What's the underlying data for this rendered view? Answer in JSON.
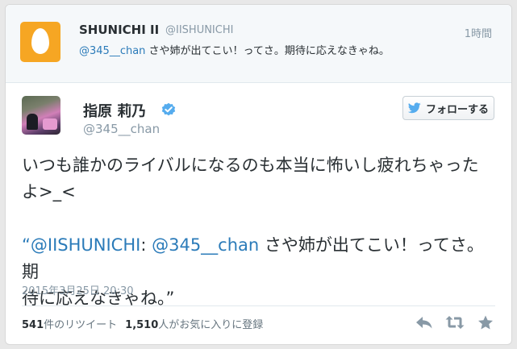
{
  "parent": {
    "name": "SHUNICHI II",
    "handle": "@IISHUNICHI",
    "time": "1時間",
    "mention": "@345__chan",
    "text": "さや姉が出てこい！ってさ。期待に応えなきゃね。"
  },
  "tweet": {
    "name": "指原 莉乃",
    "handle": "@345__chan",
    "line1": "いつも誰かのライバルになるのも本当に怖いし疲れちゃった",
    "line2": "よ>_<",
    "quote_open": "“",
    "quote_mention1": "@IISHUNICHI",
    "quote_colon": ": ",
    "quote_mention2": "@345__chan",
    "quote_text_a": " さや姉が出てこい！ってさ。期",
    "quote_text_b": "待に応えなきゃね。”",
    "timestamp": "2015年3月25日 20:30"
  },
  "follow_button": {
    "label": "フォローする"
  },
  "stats": {
    "retweets_count": "541",
    "retweets_label": "件のリツイート",
    "favorites_count": "1,510",
    "favorites_label": "人がお気に入りに登録"
  },
  "colors": {
    "link": "#2b7bb9",
    "muted": "#8899a6",
    "egg_avatar": "#f6a623",
    "verified": "#55acee"
  },
  "icons": {
    "verified": "verified-badge-icon",
    "follow": "twitter-bird-icon",
    "reply": "reply-icon",
    "retweet": "retweet-icon",
    "favorite": "star-icon"
  }
}
